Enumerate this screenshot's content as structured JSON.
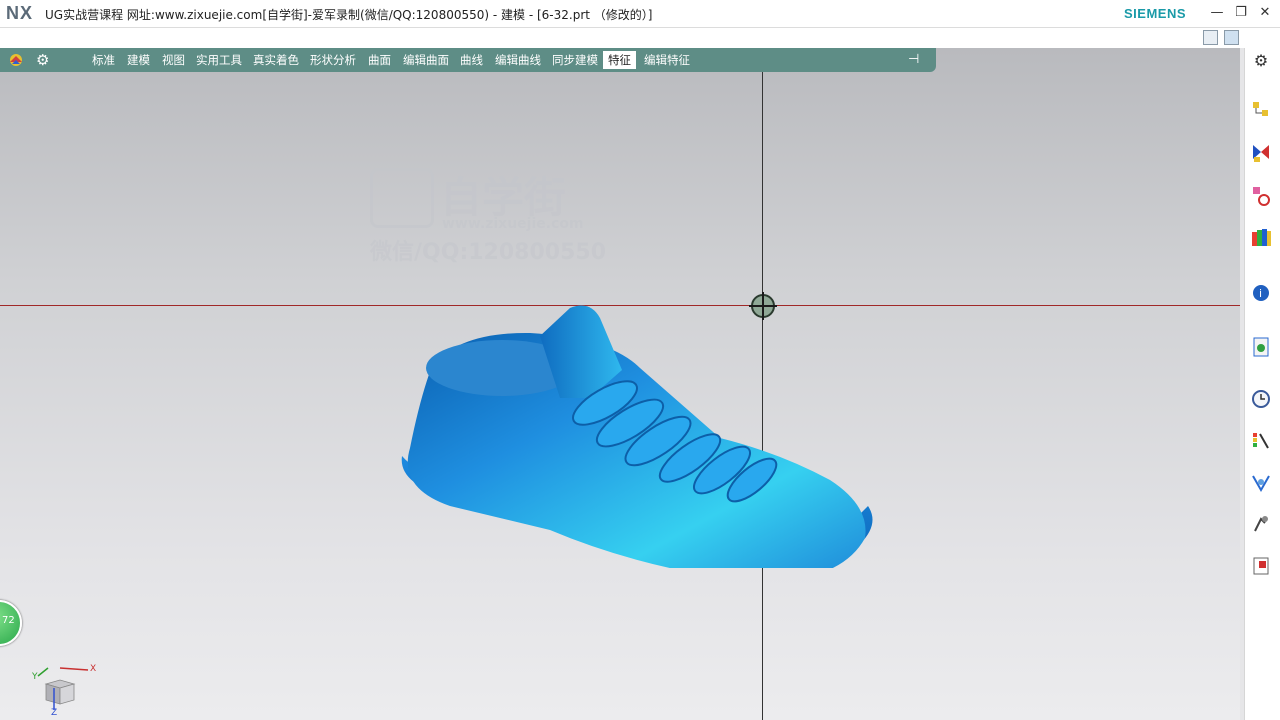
{
  "window": {
    "logo": "NX",
    "title": "UG实战营课程 网址:www.zixuejie.com[自学街]-爱军录制(微信/QQ:120800550) - 建模 - [6-32.prt （修改的）]",
    "brand": "SIEMENS",
    "buttons": {
      "minimize": "—",
      "restore": "❐",
      "close": "✕"
    }
  },
  "toolbar": {
    "tabs": [
      {
        "label": "标准"
      },
      {
        "label": "建模"
      },
      {
        "label": "视图"
      },
      {
        "label": "实用工具"
      },
      {
        "label": "真实着色"
      },
      {
        "label": "形状分析"
      },
      {
        "label": "曲面"
      },
      {
        "label": "编辑曲面"
      },
      {
        "label": "曲线"
      },
      {
        "label": "编辑曲线"
      },
      {
        "label": "同步建模"
      },
      {
        "label": "特征"
      },
      {
        "label": "编辑特征"
      }
    ],
    "active_tab": "特征",
    "gear_glyph": "⚙",
    "pin_glyph": "⊣"
  },
  "watermark": {
    "brand": "自学街",
    "url": "www.zixuejie.com",
    "contact": "微信/QQ:120800550"
  },
  "badge": {
    "text": "72"
  },
  "triad": {
    "x": "X",
    "y": "Y",
    "z": "Z"
  },
  "colors": {
    "toolbar_bg": "#5e8d86",
    "shoe_blue": "#1f8fe0",
    "brand_teal": "#1a9aa8",
    "hline": "#a02828"
  }
}
